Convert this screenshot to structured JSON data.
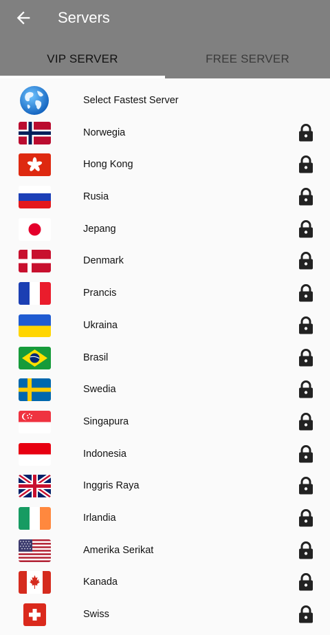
{
  "header": {
    "title": "Servers"
  },
  "tabs": [
    {
      "label": "VIP SERVER",
      "active": true
    },
    {
      "label": "FREE SERVER",
      "active": false
    }
  ],
  "fastest": {
    "label": "Select Fastest Server"
  },
  "servers": [
    {
      "name": "Norwegia",
      "flag": "norway",
      "locked": true
    },
    {
      "name": "Hong Kong",
      "flag": "hongkong",
      "locked": true
    },
    {
      "name": "Rusia",
      "flag": "russia",
      "locked": true
    },
    {
      "name": "Jepang",
      "flag": "japan",
      "locked": true
    },
    {
      "name": "Denmark",
      "flag": "denmark",
      "locked": true
    },
    {
      "name": "Prancis",
      "flag": "france",
      "locked": true
    },
    {
      "name": "Ukraina",
      "flag": "ukraine",
      "locked": true
    },
    {
      "name": "Brasil",
      "flag": "brazil",
      "locked": true
    },
    {
      "name": "Swedia",
      "flag": "sweden",
      "locked": true
    },
    {
      "name": "Singapura",
      "flag": "singapore",
      "locked": true
    },
    {
      "name": "Indonesia",
      "flag": "indonesia",
      "locked": true
    },
    {
      "name": "Inggris Raya",
      "flag": "uk",
      "locked": true
    },
    {
      "name": "Irlandia",
      "flag": "ireland",
      "locked": true
    },
    {
      "name": "Amerika Serikat",
      "flag": "usa",
      "locked": true
    },
    {
      "name": "Kanada",
      "flag": "canada",
      "locked": true
    },
    {
      "name": "Swiss",
      "flag": "switzerland",
      "locked": true
    }
  ],
  "colors": {
    "appbar": "#808080",
    "background": "#fafafa",
    "indicator": "#ffffff",
    "lock": "#222222"
  }
}
